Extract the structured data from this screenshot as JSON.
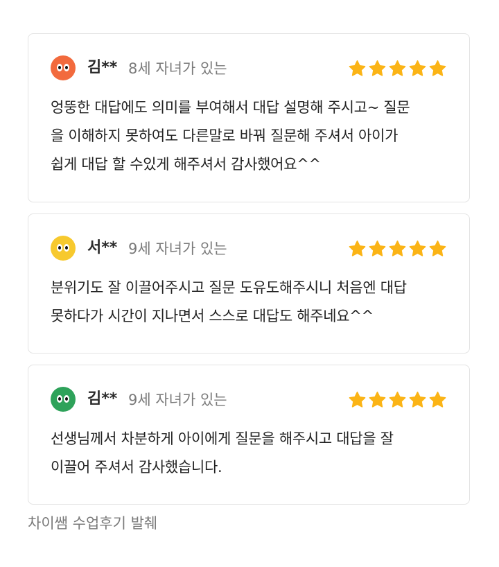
{
  "reviews": [
    {
      "name": "김**",
      "meta": "8세 자녀가 있는",
      "rating": 5,
      "avatar_color": "#f26a3d",
      "lines": [
        "엉뚱한 대답에도 의미를 부여해서 대답 설명해 주시고~ 질문",
        "을 이해하지 못하여도 다른말로 바꿔 질문해 주셔서 아이가",
        "쉽게 대답 할 수있게 해주셔서 감사했어요^^"
      ]
    },
    {
      "name": "서**",
      "meta": "9세 자녀가 있는",
      "rating": 5,
      "avatar_color": "#f7c92e",
      "lines": [
        "분위기도 잘 이끌어주시고 질문 도유도해주시니 처음엔 대답",
        "못하다가 시간이 지나면서 스스로 대답도 해주네요^^"
      ]
    },
    {
      "name": "김**",
      "meta": "9세 자녀가 있는",
      "rating": 5,
      "avatar_color": "#2ea25a",
      "lines": [
        "선생님께서 차분하게 아이에게 질문을 해주시고 대답을 잘",
        "이끌어 주셔서 감사했습니다."
      ]
    }
  ],
  "star_color": "#fbb416",
  "footer": "차이쌤 수업후기 발췌"
}
